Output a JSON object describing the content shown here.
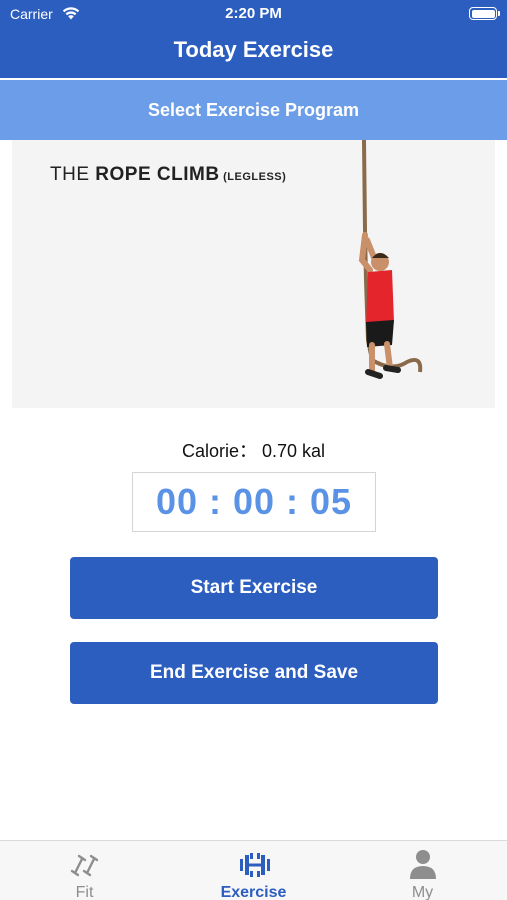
{
  "status_bar": {
    "carrier": "Carrier",
    "time": "2:20 PM"
  },
  "nav": {
    "title": "Today Exercise"
  },
  "program_selector": {
    "label": "Select Exercise Program"
  },
  "exercise_image": {
    "title_prefix": "THE ",
    "title_main": "ROPE CLIMB",
    "title_suffix": " (LEGLESS)"
  },
  "stats": {
    "calorie": "Calorie：  0.70 kal",
    "timer": "00 : 00 : 05"
  },
  "buttons": {
    "start": "Start Exercise",
    "end": "End Exercise and Save"
  },
  "tabs": [
    {
      "label": "Fit",
      "icon": "dumbbell-icon",
      "active": false
    },
    {
      "label": "Exercise",
      "icon": "barbell-icon",
      "active": true
    },
    {
      "label": "My",
      "icon": "person-icon",
      "active": false
    }
  ],
  "colors": {
    "primary": "#2c5ec0",
    "select_bar": "#6b9de8",
    "timer_text": "#5a93e6",
    "tab_inactive": "#8e8e8e"
  }
}
